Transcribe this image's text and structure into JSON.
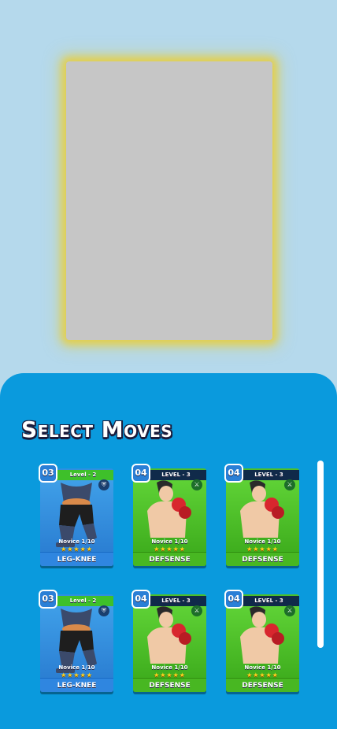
{
  "panel": {
    "title": "Select Moves"
  },
  "cards": [
    {
      "cost": "03",
      "level": "Level - 2",
      "name": "LEG-KNEE",
      "rank": "Novice 1/10",
      "stars": "★★★★★",
      "theme": "blue",
      "badge_icon": "shield-icon"
    },
    {
      "cost": "04",
      "level": "LEVEL - 3",
      "name": "DEFSENSE",
      "rank": "Novice 1/10",
      "stars": "★★★★★",
      "theme": "green",
      "badge_icon": "sword-icon"
    },
    {
      "cost": "04",
      "level": "LEVEL - 3",
      "name": "DEFSENSE",
      "rank": "Novice 1/10",
      "stars": "★★★★★",
      "theme": "green",
      "badge_icon": "sword-icon"
    },
    {
      "cost": "03",
      "level": "Level - 2",
      "name": "LEG-KNEE",
      "rank": "Novice 1/10",
      "stars": "★★★★★",
      "theme": "blue",
      "badge_icon": "shield-icon"
    },
    {
      "cost": "04",
      "level": "LEVEL - 3",
      "name": "DEFSENSE",
      "rank": "Novice 1/10",
      "stars": "★★★★★",
      "theme": "green",
      "badge_icon": "sword-icon"
    },
    {
      "cost": "04",
      "level": "LEVEL - 3",
      "name": "DEFSENSE",
      "rank": "Novice 1/10",
      "stars": "★★★★★",
      "theme": "green",
      "badge_icon": "sword-icon"
    }
  ],
  "colors": {
    "background": "#b5d9ec",
    "panel": "#0a9add",
    "preview_glow": "#e8ce3c"
  }
}
